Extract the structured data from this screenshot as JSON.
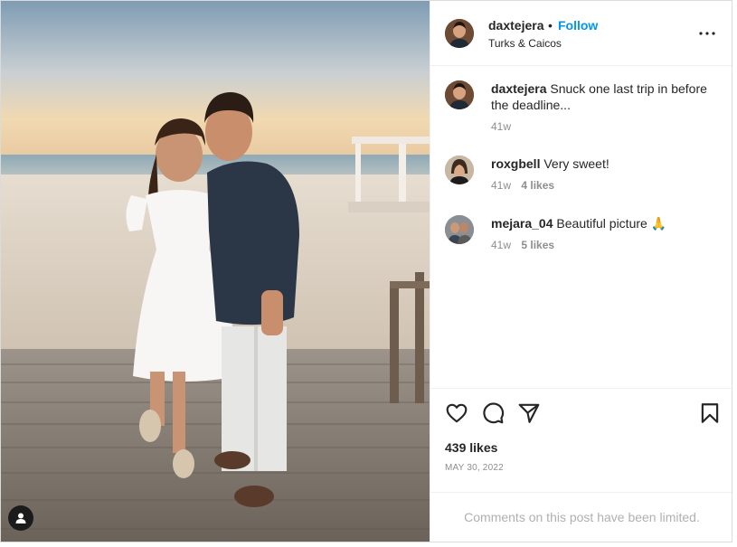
{
  "post": {
    "username": "daxtejera",
    "separator": "•",
    "follow_label": "Follow",
    "location": "Turks & Caicos",
    "more_icon": "more-horizontal-icon"
  },
  "comments": [
    {
      "username": "daxtejera",
      "text": "Snuck one last trip in before the deadline...",
      "age": "41w",
      "likes": ""
    },
    {
      "username": "roxgbell",
      "text": "Very sweet!",
      "age": "41w",
      "likes": "4 likes"
    },
    {
      "username": "mejara_04",
      "text": "Beautiful picture 🙏",
      "age": "41w",
      "likes": "5 likes"
    }
  ],
  "actions": {
    "like_icon": "heart-icon",
    "comment_icon": "comment-icon",
    "share_icon": "send-icon",
    "save_icon": "bookmark-icon",
    "likes_count": "439 likes",
    "date": "MAY 30, 2022"
  },
  "footer": {
    "limited_text": "Comments on this post have been limited."
  },
  "photo": {
    "tag_icon": "user-tag-icon"
  },
  "colors": {
    "link": "#0095f6",
    "text": "#262626",
    "secondary": "#8e8e8e",
    "border": "#efefef"
  }
}
